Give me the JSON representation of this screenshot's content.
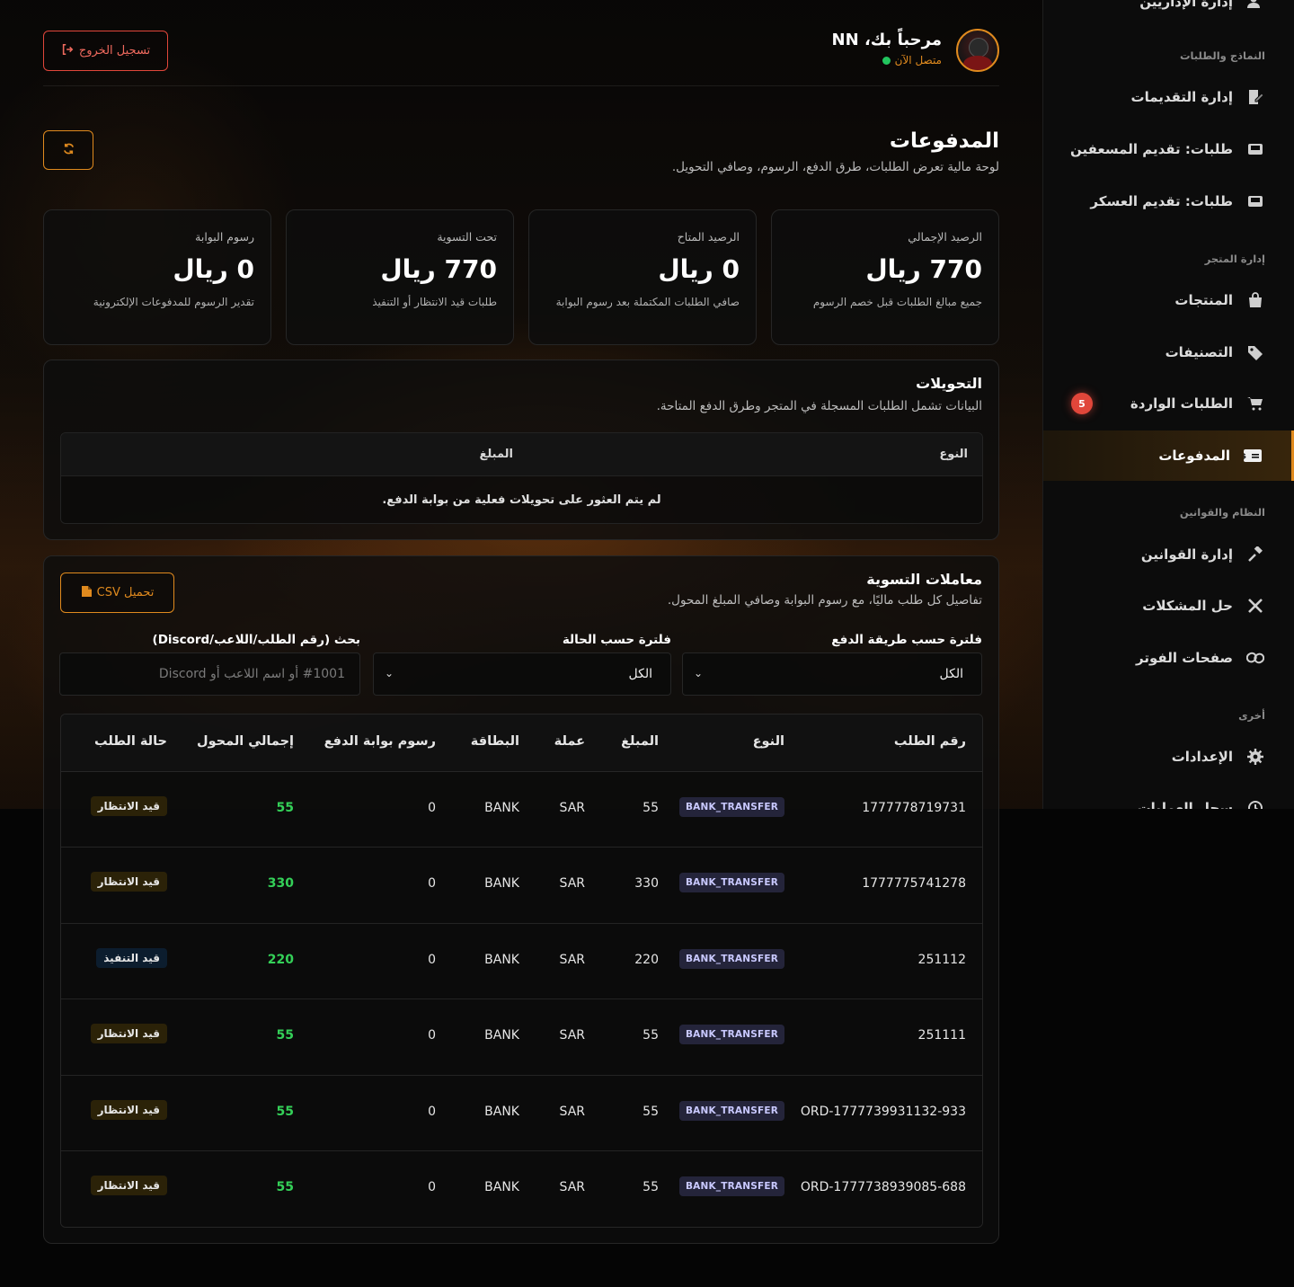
{
  "header": {
    "welcome": "مرحباً بك، NN",
    "status": "متصل الآن",
    "logout_label": "تسجيل الخروج"
  },
  "page": {
    "title": "المدفوعات",
    "subtitle": "لوحة مالية تعرض الطلبات، طرق الدفع، الرسوم، وصافي التحويل."
  },
  "stats": [
    {
      "label": "الرصيد الإجمالي",
      "value": "770 ريال",
      "desc": "جميع مبالغ الطلبات قبل خصم الرسوم"
    },
    {
      "label": "الرصيد المتاح",
      "value": "0 ريال",
      "desc": "صافي الطلبات المكتملة بعد رسوم البوابة"
    },
    {
      "label": "تحت التسوية",
      "value": "770 ريال",
      "desc": "طلبات قيد الانتظار أو التنفيذ"
    },
    {
      "label": "رسوم البوابة",
      "value": "0 ريال",
      "desc": "تقدير الرسوم للمدفوعات الإلكترونية"
    }
  ],
  "transfers": {
    "title": "التحويلات",
    "subtitle": "البيانات تشمل الطلبات المسجلة في المتجر وطرق الدفع المتاحة.",
    "col_type": "النوع",
    "col_amount": "المبلغ",
    "empty": "لم يتم العثور على تحويلات فعلية من بوابة الدفع."
  },
  "settlements": {
    "title": "معاملات التسوية",
    "subtitle": "تفاصيل كل طلب ماليًا، مع رسوم البوابة وصافي المبلغ المحول.",
    "csv_label": "تحميل CSV",
    "filter_method_label": "فلترة حسب طريقة الدفع",
    "filter_method_value": "الكل",
    "filter_status_label": "فلترة حسب الحالة",
    "filter_status_value": "الكل",
    "search_label": "بحث (رقم الطلب/اللاعب/Discord)",
    "search_placeholder": "#1001 أو اسم اللاعب أو Discord",
    "columns": {
      "order": "رقم الطلب",
      "type": "النوع",
      "amount": "المبلغ",
      "currency": "عملة",
      "card": "البطاقة",
      "fee": "رسوم بوابة الدفع",
      "net": "إجمالي المحول",
      "status": "حالة الطلب"
    },
    "rows": [
      {
        "order": "1777778719731",
        "type": "BANK_TRANSFER",
        "amount": "55",
        "currency": "SAR",
        "card": "BANK",
        "fee": "0",
        "net": "55",
        "status": "قيد الانتظار",
        "status_kind": "pending"
      },
      {
        "order": "1777775741278",
        "type": "BANK_TRANSFER",
        "amount": "330",
        "currency": "SAR",
        "card": "BANK",
        "fee": "0",
        "net": "330",
        "status": "قيد الانتظار",
        "status_kind": "pending"
      },
      {
        "order": "251112",
        "type": "BANK_TRANSFER",
        "amount": "220",
        "currency": "SAR",
        "card": "BANK",
        "fee": "0",
        "net": "220",
        "status": "قيد التنفيذ",
        "status_kind": "progress"
      },
      {
        "order": "251111",
        "type": "BANK_TRANSFER",
        "amount": "55",
        "currency": "SAR",
        "card": "BANK",
        "fee": "0",
        "net": "55",
        "status": "قيد الانتظار",
        "status_kind": "pending"
      },
      {
        "order": "ORD-1777739931132-933",
        "type": "BANK_TRANSFER",
        "amount": "55",
        "currency": "SAR",
        "card": "BANK",
        "fee": "0",
        "net": "55",
        "status": "قيد الانتظار",
        "status_kind": "pending"
      },
      {
        "order": "ORD-1777738939085-688",
        "type": "BANK_TRANSFER",
        "amount": "55",
        "currency": "SAR",
        "card": "BANK",
        "fee": "0",
        "net": "55",
        "status": "قيد الانتظار",
        "status_kind": "pending"
      }
    ]
  },
  "sidebar": {
    "top_item": "إدارة الإداريين",
    "section_forms": "النماذج والطلبات",
    "item_applications": "إدارة التقديمات",
    "item_paramedics": "طلبات: تقديم المسعفين",
    "item_military": "طلبات: تقديم العسكر",
    "section_store": "إدارة المتجر",
    "item_products": "المنتجات",
    "item_categories": "التصنيفات",
    "item_orders": "الطلبات الواردة",
    "orders_badge": "5",
    "item_payments": "المدفوعات",
    "section_system": "النظام والقوانين",
    "item_laws": "إدارة القوانين",
    "item_issues": "حل المشكلات",
    "item_footer": "صفحات الفوتر",
    "section_other": "أخرى",
    "item_settings": "الإعدادات",
    "item_logs": "سجل العمليات"
  },
  "colors": {
    "accent": "#e08a1e",
    "danger": "#e0463a",
    "success": "#34d058",
    "pending": "#eab308",
    "progress": "#4aa3ff"
  }
}
